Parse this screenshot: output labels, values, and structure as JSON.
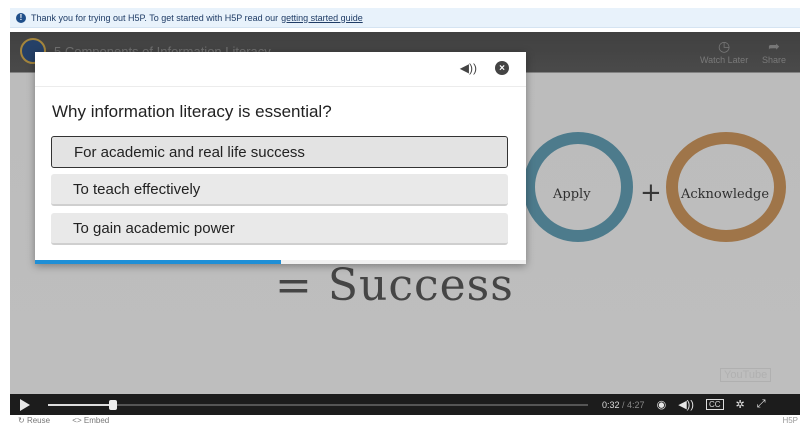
{
  "notice": {
    "text": "Thank you for trying out H5P. To get started with H5P read our",
    "link": "getting started guide"
  },
  "video": {
    "title": "5 Components of Information Literacy",
    "buttons": [
      {
        "label": "Watch Later",
        "icon": "clock-icon"
      },
      {
        "label": "Share",
        "icon": "share-icon"
      }
    ],
    "ring_apply": "Apply",
    "ring_acknowledge": "Acknowledge",
    "plus": "+",
    "success": "= Success",
    "watermark": "YouTube"
  },
  "controls": {
    "current_time": "0:32",
    "duration": "/ 4:27",
    "cc_label": "CC",
    "played_fraction": 0.12,
    "volume_fraction": 0.2
  },
  "footer": {
    "reuse": "Reuse",
    "embed": "<> Embed",
    "right": "H5P"
  },
  "quiz": {
    "question": "Why information literacy is essential?",
    "options": [
      {
        "label": "For academic and real life success",
        "selected": true
      },
      {
        "label": "To teach effectively",
        "selected": false
      },
      {
        "label": "To gain academic power",
        "selected": false
      }
    ],
    "progress_fraction": 0.5
  },
  "colors": {
    "accent": "#1f8fd6",
    "ring_apply": "#5f97ab",
    "ring_acknowledge": "#c28f5a"
  }
}
